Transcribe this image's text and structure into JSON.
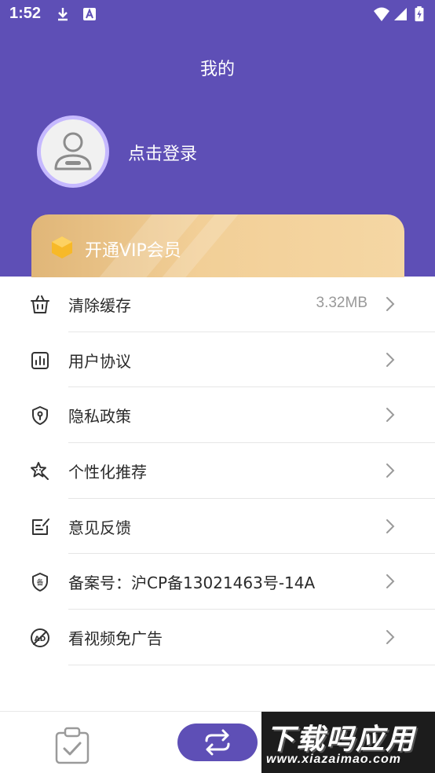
{
  "status_bar": {
    "time": "1:52"
  },
  "header": {
    "title": "我的",
    "login_text": "点击登录",
    "vip_label": "开通VIP会员",
    "colors": {
      "primary": "#5e4fb6",
      "avatar_ring": "#c6b9ff",
      "vip_gold": "#f2cf97"
    }
  },
  "menu": {
    "items": [
      {
        "label": "清除缓存",
        "value": "3.32MB",
        "icon": "basket-icon"
      },
      {
        "label": "用户协议",
        "value": "",
        "icon": "chart-doc-icon"
      },
      {
        "label": "隐私政策",
        "value": "",
        "icon": "shield-lock-icon"
      },
      {
        "label": "个性化推荐",
        "value": "",
        "icon": "star-cursor-icon"
      },
      {
        "label": "意见反馈",
        "value": "",
        "icon": "edit-note-icon"
      },
      {
        "label": "备案号：沪CP备13021463号-14A",
        "value": "",
        "icon": "badge-icon"
      },
      {
        "label": "看视频免广告",
        "value": "",
        "icon": "no-ad-icon"
      }
    ]
  },
  "bottom_nav": {
    "items": [
      {
        "icon": "task-clipboard-icon"
      },
      {
        "icon": "switch-arrows-icon"
      }
    ]
  },
  "watermark": {
    "brand": "下载吗应用",
    "url": "www.xiazaimao.com"
  }
}
